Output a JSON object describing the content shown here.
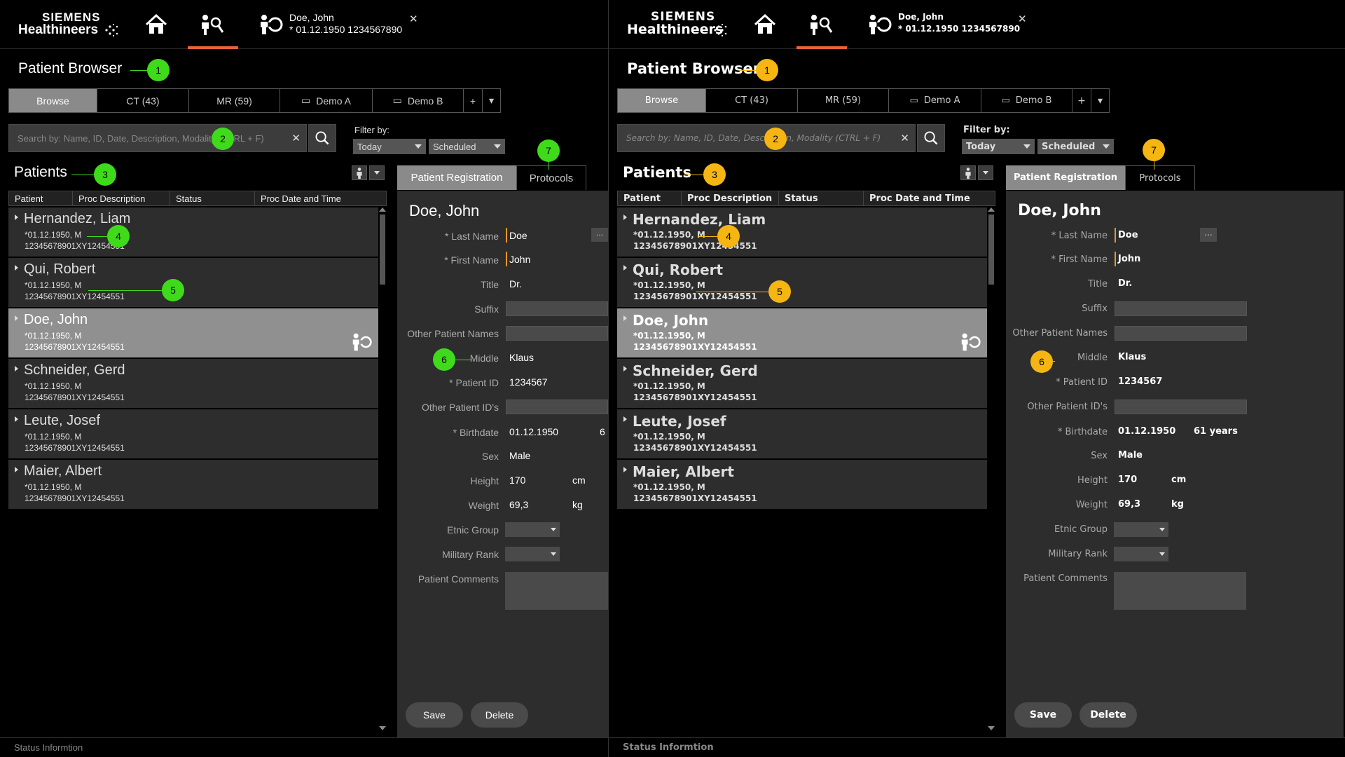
{
  "header": {
    "brand_line1": "SIEMENS",
    "brand_line2": "Healthineers",
    "patient_name": "Doe, John",
    "patient_dob": "* 01.12.1950 1234567890",
    "icons": [
      "home-icon",
      "patient-browser-icon",
      "patient-icon",
      "close-icon"
    ]
  },
  "browser": {
    "title": "Patient Browser",
    "tabs": [
      {
        "label": "Browse",
        "active": true
      },
      {
        "label": "CT (43)"
      },
      {
        "label": "MR (59)"
      },
      {
        "label": "Demo A",
        "icon": "monitor-icon"
      },
      {
        "label": "Demo B",
        "icon": "monitor-icon"
      },
      {
        "label": "+"
      }
    ],
    "search_placeholder": "Search by: Name, ID, Date, Description, Modality (CTRL + F)",
    "filter_label": "Filter by:",
    "filter_date": "Today",
    "filter_state": "Scheduled",
    "patients_heading": "Patients",
    "columns": [
      "Patient",
      "Proc Description",
      "Status",
      "Proc Date and Time"
    ]
  },
  "patients": [
    {
      "name": "Hernandez, Liam",
      "line1": "*01.12.1950, M",
      "line2": "12345678901XY12454551"
    },
    {
      "name": "Qui, Robert",
      "line1": "*01.12.1950, M",
      "line2": "12345678901XY12454551"
    },
    {
      "name": "Doe, John",
      "line1": "*01.12.1950, M",
      "line2": "12345678901XY12454551",
      "selected": true
    },
    {
      "name": "Schneider, Gerd",
      "line1": "*01.12.1950, M",
      "line2": "12345678901XY12454551"
    },
    {
      "name": "Leute, Josef",
      "line1": "*01.12.1950, M",
      "line2": "12345678901XY12454551"
    },
    {
      "name": "Maier, Albert",
      "line1": "*01.12.1950, M",
      "line2": "12345678901XY12454551"
    }
  ],
  "registration": {
    "tab_active": "Patient Registration",
    "tab_other": "Protocols",
    "patient_name": "Doe, John",
    "labels": {
      "last_name": "* Last Name",
      "first_name": "* First Name",
      "title": "Title",
      "suffix": "Suffix",
      "other_names": "Other Patient Names",
      "middle": "Middle",
      "patient_id": "* Patient ID",
      "other_ids": "Other Patient ID's",
      "birthdate": "* Birthdate",
      "sex": "Sex",
      "height": "Height",
      "weight": "Weight",
      "ethnic_group": "Etnic Group",
      "military_rank": "Military Rank",
      "comments": "Patient Comments"
    },
    "values": {
      "last_name": "Doe",
      "first_name": "John",
      "title": "Dr.",
      "middle": "Klaus",
      "patient_id": "1234567",
      "birthdate": "01.12.1950",
      "age": "61 years",
      "age_clipped": "6",
      "sex": "Male",
      "height": "170",
      "height_unit": "cm",
      "weight": "69,3",
      "weight_unit": "kg"
    },
    "dots_label": "...",
    "save_label": "Save",
    "delete_label": "Delete"
  },
  "status_text": "Status Informtion",
  "callouts": [
    "1",
    "2",
    "3",
    "4",
    "5",
    "6",
    "7"
  ],
  "colors": {
    "accent": "#e8613a",
    "callout_green": "#3fdb1b",
    "callout_orange": "#f5b512",
    "field_accent": "#e8962a"
  }
}
